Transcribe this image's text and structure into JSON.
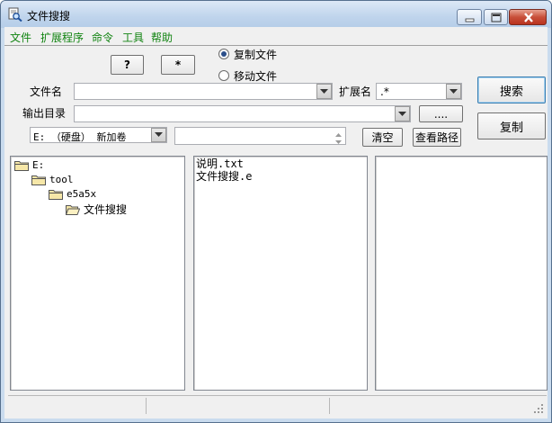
{
  "window": {
    "title": "文件搜搜",
    "colors": {
      "menu_text": "#128412",
      "titlebar": "#c9dbee",
      "close_button": "#c8503a"
    }
  },
  "menu": [
    "文件",
    "扩展程序",
    "命令",
    "工具",
    "帮助"
  ],
  "toolbar": {
    "help_button": "?",
    "star_button": "*"
  },
  "mode": {
    "options": [
      "复制文件",
      "移动文件"
    ],
    "selected": "复制文件"
  },
  "form": {
    "filename_label": "文件名",
    "filename_value": "",
    "extension_label": "扩展名",
    "extension_value": ".*",
    "output_dir_label": "输出目录",
    "output_dir_value": "",
    "browse_button": "....",
    "drive_value": "E: （硬盘） 新加卷",
    "spinner_value": "",
    "clear_button": "清空",
    "view_path_button": "查看路径",
    "search_button": "搜索",
    "copy_button": "复制"
  },
  "tree": [
    {
      "label": "E:",
      "level": 0,
      "icon": "folder-icon"
    },
    {
      "label": "tool",
      "level": 1,
      "icon": "folder-icon"
    },
    {
      "label": "e5a5x",
      "level": 2,
      "icon": "folder-icon"
    },
    {
      "label": "文件搜搜",
      "level": 3,
      "icon": "open-folder-icon",
      "selected": true
    }
  ],
  "files": [
    "说明.txt",
    "文件搜搜.e"
  ],
  "status": [
    "",
    "",
    ""
  ]
}
